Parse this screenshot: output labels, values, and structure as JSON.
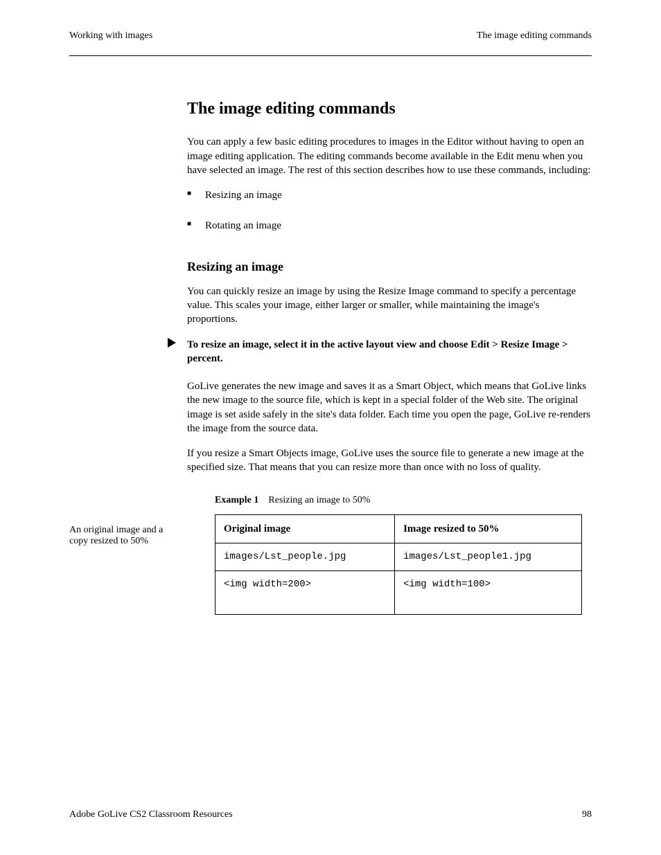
{
  "header": {
    "left": "Working with images",
    "right": "The image editing commands"
  },
  "section_title": "The image editing commands",
  "intro": "You can apply a few basic editing procedures to images in the Editor without having to open an image editing application. The editing commands become available in the Edit menu when you have selected an image. The rest of this section describes how to use these commands, including:",
  "bullets": [
    "Resizing an image",
    "Rotating an image"
  ],
  "resize": {
    "heading": "Resizing an image",
    "para1": "You can quickly resize an image by using the Resize Image command to specify a percentage value. This scales your image, either larger or smaller, while maintaining the image's proportions.",
    "step": "To resize an image, select it in the active layout view and choose Edit > Resize Image > percent.",
    "para2": "GoLive generates the new image and saves it as a Smart Object, which means that GoLive links the new image to the source file, which is kept in a special folder of the Web site. The original image is set aside safely in the site's data folder. Each time you open the page, GoLive re-renders the image from the source data.",
    "para3": "If you resize a Smart Objects image, GoLive uses the source file to generate a new image at the specified size. That means that you can resize more than once with no loss of quality."
  },
  "sidelabel": "An original image and a copy resized to 50%",
  "table": {
    "caption_label": "Example 1",
    "caption_text": "Resizing an image to 50%",
    "headers": [
      "Original image",
      "Image resized to 50%"
    ],
    "rows": [
      [
        "images/Lst_people.jpg",
        "images/Lst_people1.jpg"
      ],
      [
        "<img width=200>",
        "<img width=100>"
      ]
    ]
  },
  "footer": {
    "left": "Adobe GoLive CS2 Classroom Resources",
    "right": "98"
  }
}
